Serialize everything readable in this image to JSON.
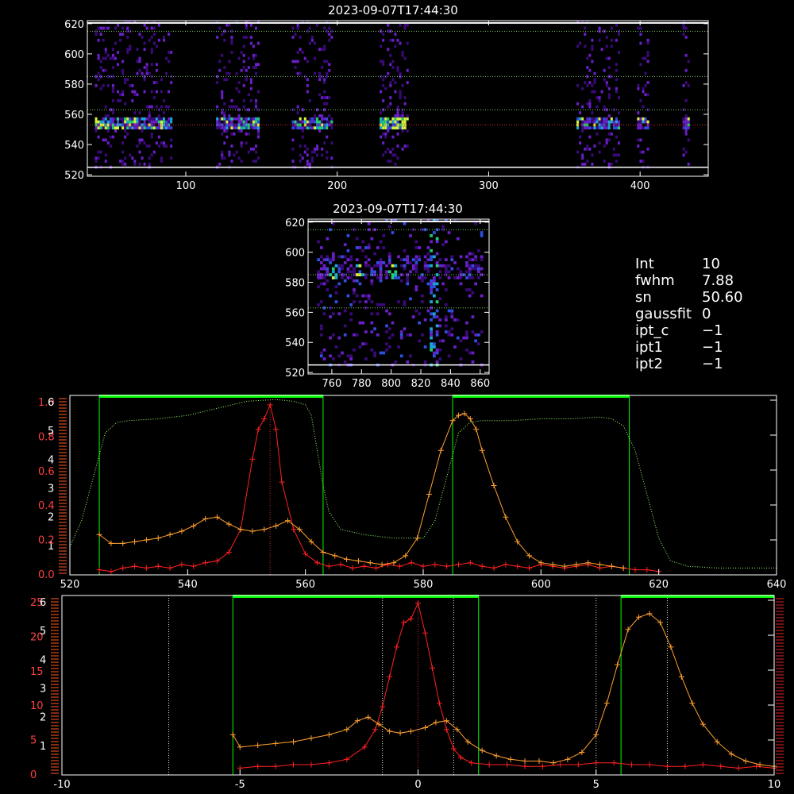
{
  "colors": {
    "red": "#ff2020",
    "orange": "#ffa030",
    "green": "#00ff00",
    "greenDot": "#9cff70",
    "hotbox": "#ff2020"
  },
  "info": {
    "rows": [
      {
        "label": "Int",
        "value": "10"
      },
      {
        "label": "fwhm",
        "value": "7.88"
      },
      {
        "label": "sn",
        "value": "50.60"
      },
      {
        "label": "gaussfit",
        "value": "0"
      },
      {
        "label": "ipt_c",
        "value": "−1"
      },
      {
        "label": "ipt1",
        "value": "−1"
      },
      {
        "label": "ipt2",
        "value": "−1"
      }
    ]
  },
  "chart_data": [
    {
      "type": "heatmap",
      "title": "2023-09-07T17:44:30",
      "xlim": [
        35,
        445
      ],
      "ylim": [
        519,
        622
      ],
      "xticks": [
        100,
        200,
        300,
        400
      ],
      "yticks": [
        520,
        540,
        560,
        580,
        600,
        620
      ],
      "hlines": [
        {
          "y": 615,
          "style": "green-dotted"
        },
        {
          "y": 585,
          "style": "green-dotted"
        },
        {
          "y": 563,
          "style": "green-dotted"
        },
        {
          "y": 553,
          "style": "red-dotted"
        },
        {
          "y": 525,
          "style": "white-solid"
        }
      ],
      "strips": [
        [
          40,
          90
        ],
        [
          120,
          148
        ],
        [
          170,
          196
        ],
        [
          228,
          246
        ],
        [
          358,
          386
        ],
        [
          398,
          406
        ],
        [
          428,
          432
        ]
      ]
    },
    {
      "type": "heatmap",
      "title": "2023-09-07T17:44:30",
      "xlim": [
        744,
        866
      ],
      "ylim": [
        519,
        622
      ],
      "xticks": [
        760,
        780,
        800,
        820,
        840,
        860
      ],
      "yticks": [
        520,
        540,
        560,
        580,
        600,
        620
      ],
      "hlines": [
        {
          "y": 615,
          "style": "green-dotted"
        },
        {
          "y": 585,
          "style": "green-dotted"
        },
        {
          "y": 563,
          "style": "green-dotted"
        },
        {
          "y": 525,
          "style": "white-solid"
        }
      ]
    },
    {
      "type": "line",
      "xlim": [
        520,
        640
      ],
      "xticks": [
        520,
        540,
        560,
        580,
        600,
        620,
        640
      ],
      "left_ticks_a": [
        "0.0",
        "0.2",
        "0.4",
        "0.6",
        "0.8",
        "1.0"
      ],
      "left_ticks_b": [
        "1",
        "2",
        "3",
        "4",
        "5",
        "6"
      ],
      "green_boxes": [
        [
          525,
          563
        ],
        [
          585,
          615
        ]
      ],
      "vline": 554,
      "series": [
        {
          "color": "red",
          "x": [
            525,
            527,
            529,
            531,
            533,
            535,
            537,
            539,
            541,
            543,
            545,
            547,
            549,
            551,
            552,
            553,
            554,
            555,
            556,
            558,
            560,
            562,
            564,
            566,
            568,
            570,
            572,
            574,
            576,
            578,
            580,
            582,
            584,
            586,
            588,
            590,
            592,
            594,
            596,
            598,
            600,
            602,
            604,
            606,
            608,
            610,
            612,
            614,
            616,
            618,
            620
          ],
          "y": [
            0.02,
            0.01,
            0.03,
            0.04,
            0.03,
            0.04,
            0.03,
            0.05,
            0.04,
            0.06,
            0.07,
            0.12,
            0.25,
            0.65,
            0.82,
            0.88,
            0.96,
            0.82,
            0.52,
            0.25,
            0.11,
            0.06,
            0.04,
            0.05,
            0.03,
            0.04,
            0.03,
            0.05,
            0.04,
            0.06,
            0.04,
            0.05,
            0.04,
            0.05,
            0.06,
            0.04,
            0.03,
            0.05,
            0.04,
            0.03,
            0.05,
            0.04,
            0.03,
            0.04,
            0.05,
            0.03,
            0.04,
            0.03,
            0.02,
            0.02,
            0.01
          ]
        },
        {
          "color": "orange",
          "x": [
            525,
            527,
            529,
            531,
            533,
            535,
            537,
            539,
            541,
            543,
            545,
            547,
            549,
            551,
            553,
            555,
            557,
            559,
            561,
            563,
            565,
            567,
            569,
            571,
            573,
            575,
            577,
            579,
            581,
            583,
            585,
            586,
            587,
            588,
            589,
            590,
            592,
            594,
            596,
            598,
            600,
            602,
            604,
            606,
            608,
            610,
            612,
            614
          ],
          "y": [
            0.22,
            0.17,
            0.17,
            0.18,
            0.19,
            0.2,
            0.22,
            0.24,
            0.27,
            0.31,
            0.32,
            0.28,
            0.25,
            0.24,
            0.25,
            0.27,
            0.3,
            0.25,
            0.18,
            0.12,
            0.1,
            0.08,
            0.07,
            0.06,
            0.05,
            0.06,
            0.1,
            0.2,
            0.45,
            0.7,
            0.87,
            0.9,
            0.91,
            0.88,
            0.82,
            0.7,
            0.5,
            0.32,
            0.18,
            0.1,
            0.06,
            0.05,
            0.04,
            0.05,
            0.06,
            0.05,
            0.04,
            0.03
          ]
        },
        {
          "color": "greenDot",
          "x": [
            520,
            522,
            524,
            526,
            528,
            530,
            535,
            540,
            545,
            550,
            555,
            558,
            560,
            561,
            562,
            563,
            564,
            566,
            570,
            575,
            580,
            582,
            584,
            586,
            588,
            590,
            595,
            600,
            605,
            610,
            612,
            614,
            616,
            618,
            620,
            622,
            625,
            630,
            635,
            640
          ],
          "y": [
            0.15,
            0.3,
            0.55,
            0.8,
            0.86,
            0.87,
            0.88,
            0.9,
            0.94,
            0.98,
            0.99,
            0.98,
            0.96,
            0.9,
            0.7,
            0.5,
            0.35,
            0.25,
            0.22,
            0.2,
            0.2,
            0.3,
            0.55,
            0.8,
            0.86,
            0.87,
            0.87,
            0.88,
            0.88,
            0.89,
            0.88,
            0.84,
            0.7,
            0.45,
            0.2,
            0.07,
            0.04,
            0.03,
            0.03,
            0.03
          ]
        }
      ]
    },
    {
      "type": "line",
      "xlim": [
        -10,
        10
      ],
      "xticks": [
        -10,
        -5,
        0,
        5,
        10
      ],
      "left_ticks_a": [
        "0",
        "5",
        "10",
        "15",
        "20",
        "25"
      ],
      "left_ticks_b": [
        "1",
        "2",
        "3",
        "4",
        "5",
        "6"
      ],
      "green_boxes": [
        [
          -5.2,
          1.7
        ],
        [
          5.7,
          10
        ]
      ],
      "white_vlines": [
        -7,
        -1,
        1,
        5,
        7
      ],
      "vline": 0,
      "series": [
        {
          "color": "red",
          "x": [
            -5,
            -4.5,
            -4,
            -3.5,
            -3,
            -2.5,
            -2,
            -1.5,
            -1.2,
            -1,
            -0.8,
            -0.6,
            -0.4,
            -0.2,
            0,
            0.2,
            0.4,
            0.6,
            0.8,
            1,
            1.2,
            1.5,
            2,
            2.5,
            3,
            3.5,
            4,
            4.5,
            5,
            5.5,
            6,
            6.5,
            7,
            7.5,
            8,
            8.5,
            9,
            9.5,
            10
          ],
          "y": [
            0.03,
            0.04,
            0.04,
            0.05,
            0.05,
            0.06,
            0.08,
            0.15,
            0.25,
            0.38,
            0.55,
            0.72,
            0.86,
            0.88,
            0.97,
            0.8,
            0.6,
            0.4,
            0.25,
            0.14,
            0.09,
            0.06,
            0.05,
            0.05,
            0.04,
            0.04,
            0.05,
            0.05,
            0.06,
            0.06,
            0.05,
            0.05,
            0.04,
            0.04,
            0.05,
            0.04,
            0.03,
            0.04,
            0.03
          ]
        },
        {
          "color": "orange",
          "x": [
            -5.2,
            -5,
            -4.5,
            -4,
            -3.5,
            -3,
            -2.5,
            -2,
            -1.7,
            -1.4,
            -1.1,
            -0.8,
            -0.5,
            -0.2,
            0.2,
            0.5,
            0.8,
            1.1,
            1.4,
            1.8,
            2.2,
            2.6,
            3,
            3.4,
            3.8,
            4.2,
            4.6,
            5,
            5.3,
            5.6,
            5.9,
            6.2,
            6.5,
            6.8,
            7.1,
            7.4,
            7.7,
            8,
            8.4,
            8.8,
            9.2,
            9.6,
            10
          ],
          "y": [
            0.22,
            0.15,
            0.16,
            0.17,
            0.18,
            0.2,
            0.22,
            0.25,
            0.3,
            0.32,
            0.28,
            0.24,
            0.23,
            0.24,
            0.26,
            0.29,
            0.3,
            0.25,
            0.18,
            0.13,
            0.1,
            0.08,
            0.07,
            0.07,
            0.06,
            0.08,
            0.12,
            0.22,
            0.4,
            0.62,
            0.82,
            0.89,
            0.91,
            0.86,
            0.72,
            0.55,
            0.4,
            0.28,
            0.18,
            0.11,
            0.07,
            0.05,
            0.04
          ]
        }
      ]
    }
  ]
}
